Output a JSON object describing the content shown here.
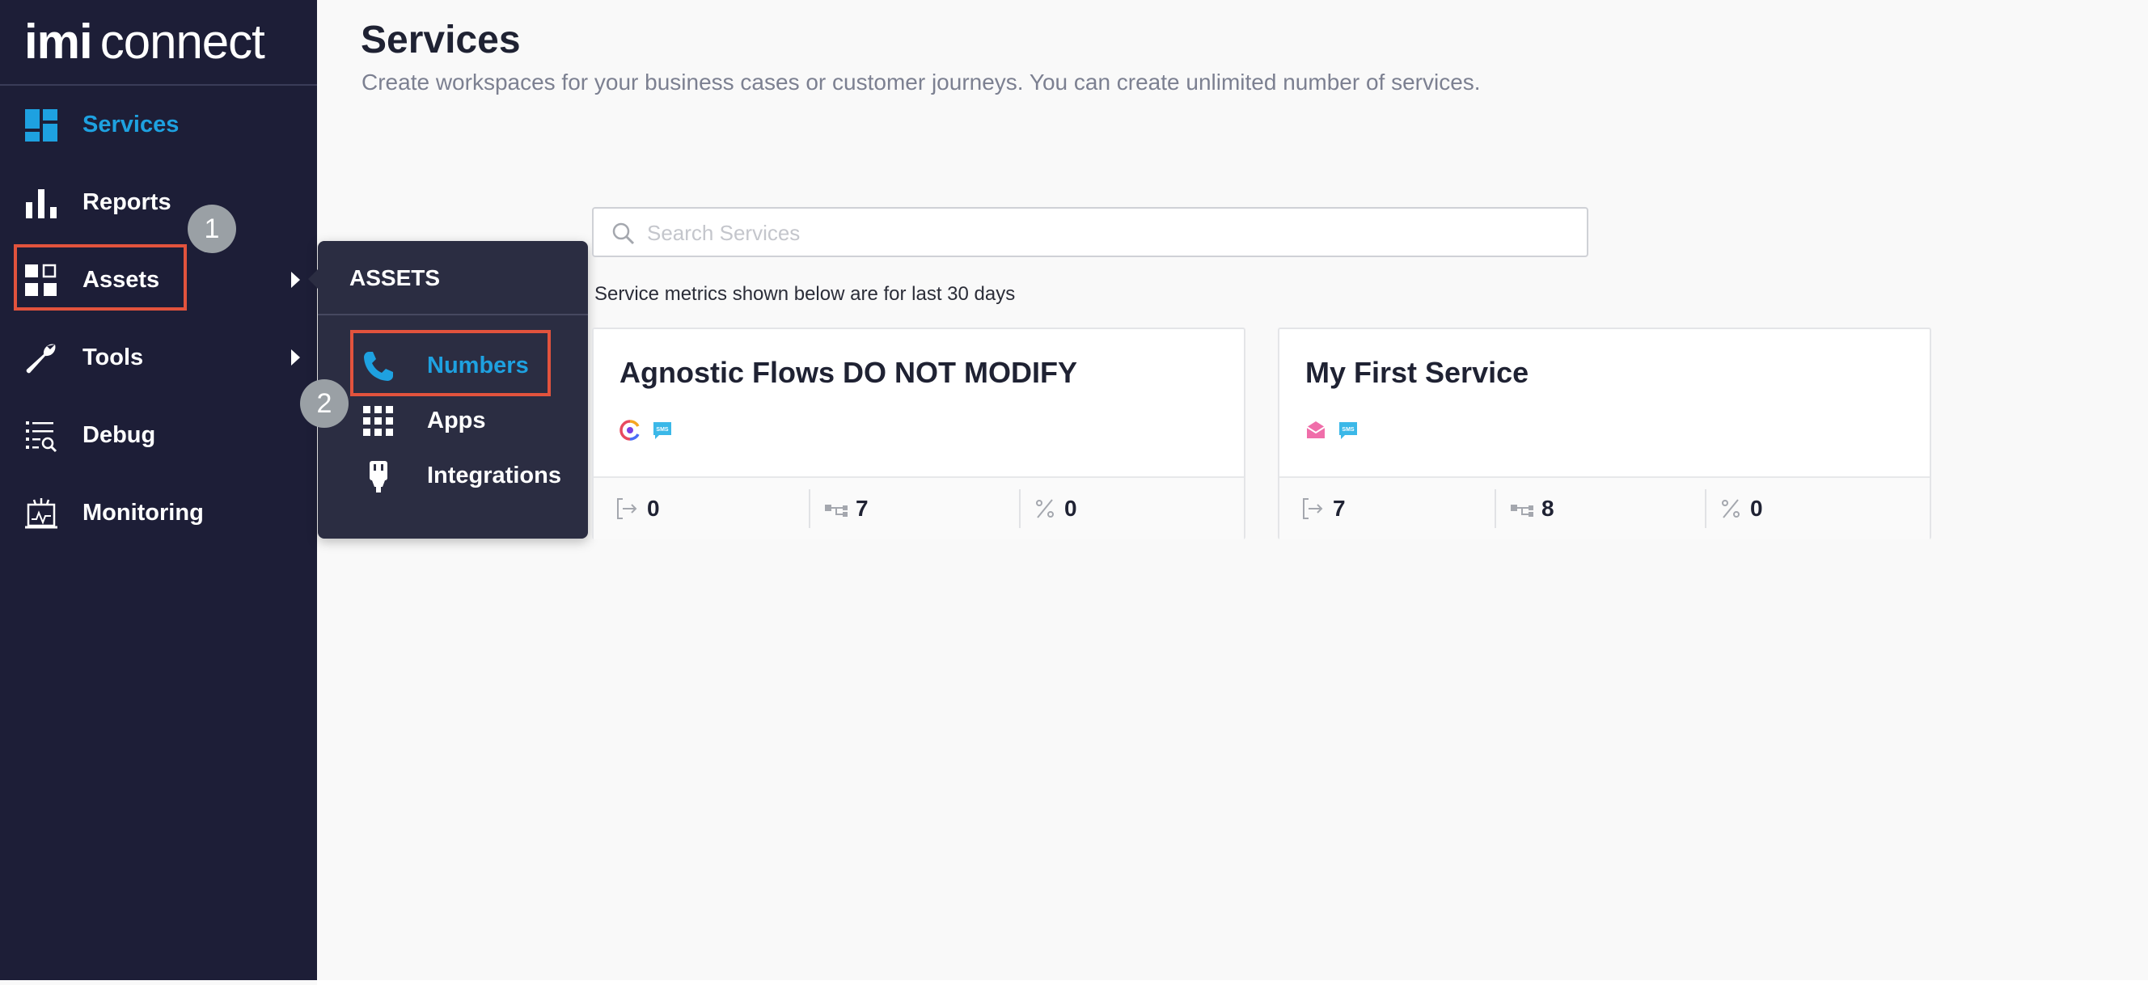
{
  "app": {
    "logo_bold": "imi",
    "logo_light": "connect"
  },
  "sidebar": {
    "items": [
      {
        "label": "Services"
      },
      {
        "label": "Reports"
      },
      {
        "label": "Assets"
      },
      {
        "label": "Tools"
      },
      {
        "label": "Debug"
      },
      {
        "label": "Monitoring"
      }
    ]
  },
  "annotations": {
    "step1": "1",
    "step2": "2"
  },
  "flyout": {
    "title": "ASSETS",
    "items": [
      {
        "label": "Numbers"
      },
      {
        "label": "Apps"
      },
      {
        "label": "Integrations"
      }
    ]
  },
  "main": {
    "title": "Services",
    "subtitle": "Create workspaces for your business cases or customer journeys. You can create unlimited number of services.",
    "search_placeholder": "Search Services",
    "metrics_note": "Service metrics shown below are for last 30 days",
    "cards": [
      {
        "title": "Agnostic Flows DO NOT MODIFY",
        "channels": [
          "custom-channel-icon",
          "sms-icon"
        ],
        "metrics": {
          "inbound": "0",
          "flows": "7",
          "percent": "0"
        }
      },
      {
        "title": "My First Service",
        "channels": [
          "email-icon",
          "sms-icon"
        ],
        "metrics": {
          "inbound": "7",
          "flows": "8",
          "percent": "0"
        }
      }
    ]
  },
  "colors": {
    "sidebar_bg": "#1d1e37",
    "accent": "#1ea1e0",
    "highlight_box": "#e2533d",
    "badge": "#9aa0a5"
  }
}
